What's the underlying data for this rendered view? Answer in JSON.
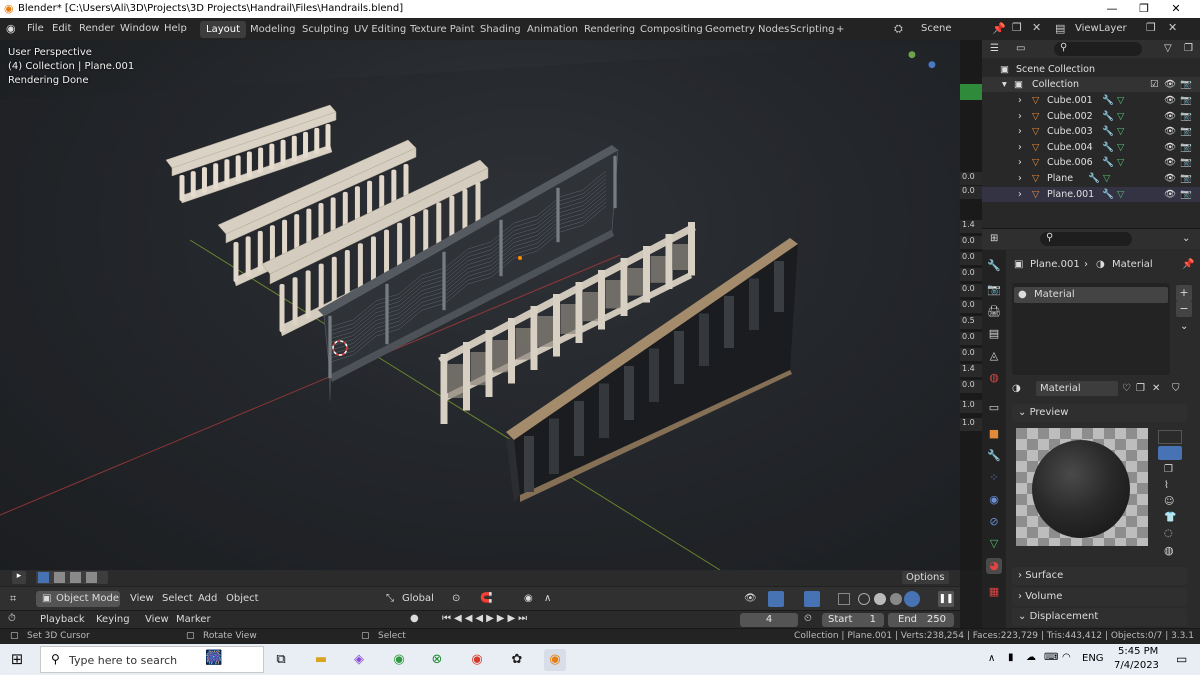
{
  "window": {
    "title": "Blender* [C:\\Users\\Ali\\3D\\Projects\\3D Projects\\Handrail\\Files\\Handrails.blend]"
  },
  "menu": {
    "items": [
      "File",
      "Edit",
      "Render",
      "Window",
      "Help"
    ]
  },
  "workspaces": {
    "tabs": [
      "Layout",
      "Modeling",
      "Sculpting",
      "UV Editing",
      "Texture Paint",
      "Shading",
      "Animation",
      "Rendering",
      "Compositing",
      "Geometry Nodes",
      "Scripting"
    ],
    "active": "Layout",
    "add": "+"
  },
  "scene": {
    "label": "Scene"
  },
  "view_layer": {
    "label": "ViewLayer"
  },
  "viewport": {
    "overlay_lines": [
      "User Perspective",
      "(4) Collection | Plane.001",
      "Rendering Done"
    ],
    "options_label": "Options"
  },
  "object_header": {
    "mode": "Object Mode",
    "menus": [
      "View",
      "Select",
      "Add",
      "Object"
    ],
    "transform": "Global"
  },
  "timeline": {
    "menus": [
      "Playback",
      "Keying",
      "View",
      "Marker"
    ],
    "current_frame": "4",
    "start_label": "Start",
    "start": "1",
    "end_label": "End",
    "end": "250"
  },
  "statusbar": {
    "left": "Set 3D Cursor",
    "middle": "Rotate View",
    "right_hint": "Select",
    "stats": "Collection | Plane.001 | Verts:238,254 | Faces:223,729 | Tris:443,412 | Objects:0/7 | 3.3.1"
  },
  "outliner": {
    "root": "Scene Collection",
    "collection": "Collection",
    "items": [
      "Cube.001",
      "Cube.002",
      "Cube.003",
      "Cube.004",
      "Cube.006",
      "Plane",
      "Plane.001"
    ]
  },
  "strip_values": [
    "0.0",
    "0.0",
    "1.4",
    "0.0",
    "0.0",
    "0.0",
    "0.0",
    "0.0",
    "0.5",
    "0.0",
    "0.0",
    "1.4",
    "0.0",
    "1.0",
    "1.0"
  ],
  "properties": {
    "breadcrumb_object": "Plane.001",
    "breadcrumb_material": "Material",
    "slot_name": "Material",
    "material_name": "Material",
    "panels": [
      "Preview",
      "Surface",
      "Volume",
      "Displacement"
    ]
  },
  "taskbar": {
    "search_placeholder": "Type here to search",
    "language": "ENG",
    "time": "5:45 PM",
    "date": "7/4/2023"
  },
  "colors": {
    "accent": "#4772b3",
    "object_orange": "#e08a3a",
    "modifier_blue": "#6a8fd8",
    "mesh_green": "#4fc16f"
  }
}
